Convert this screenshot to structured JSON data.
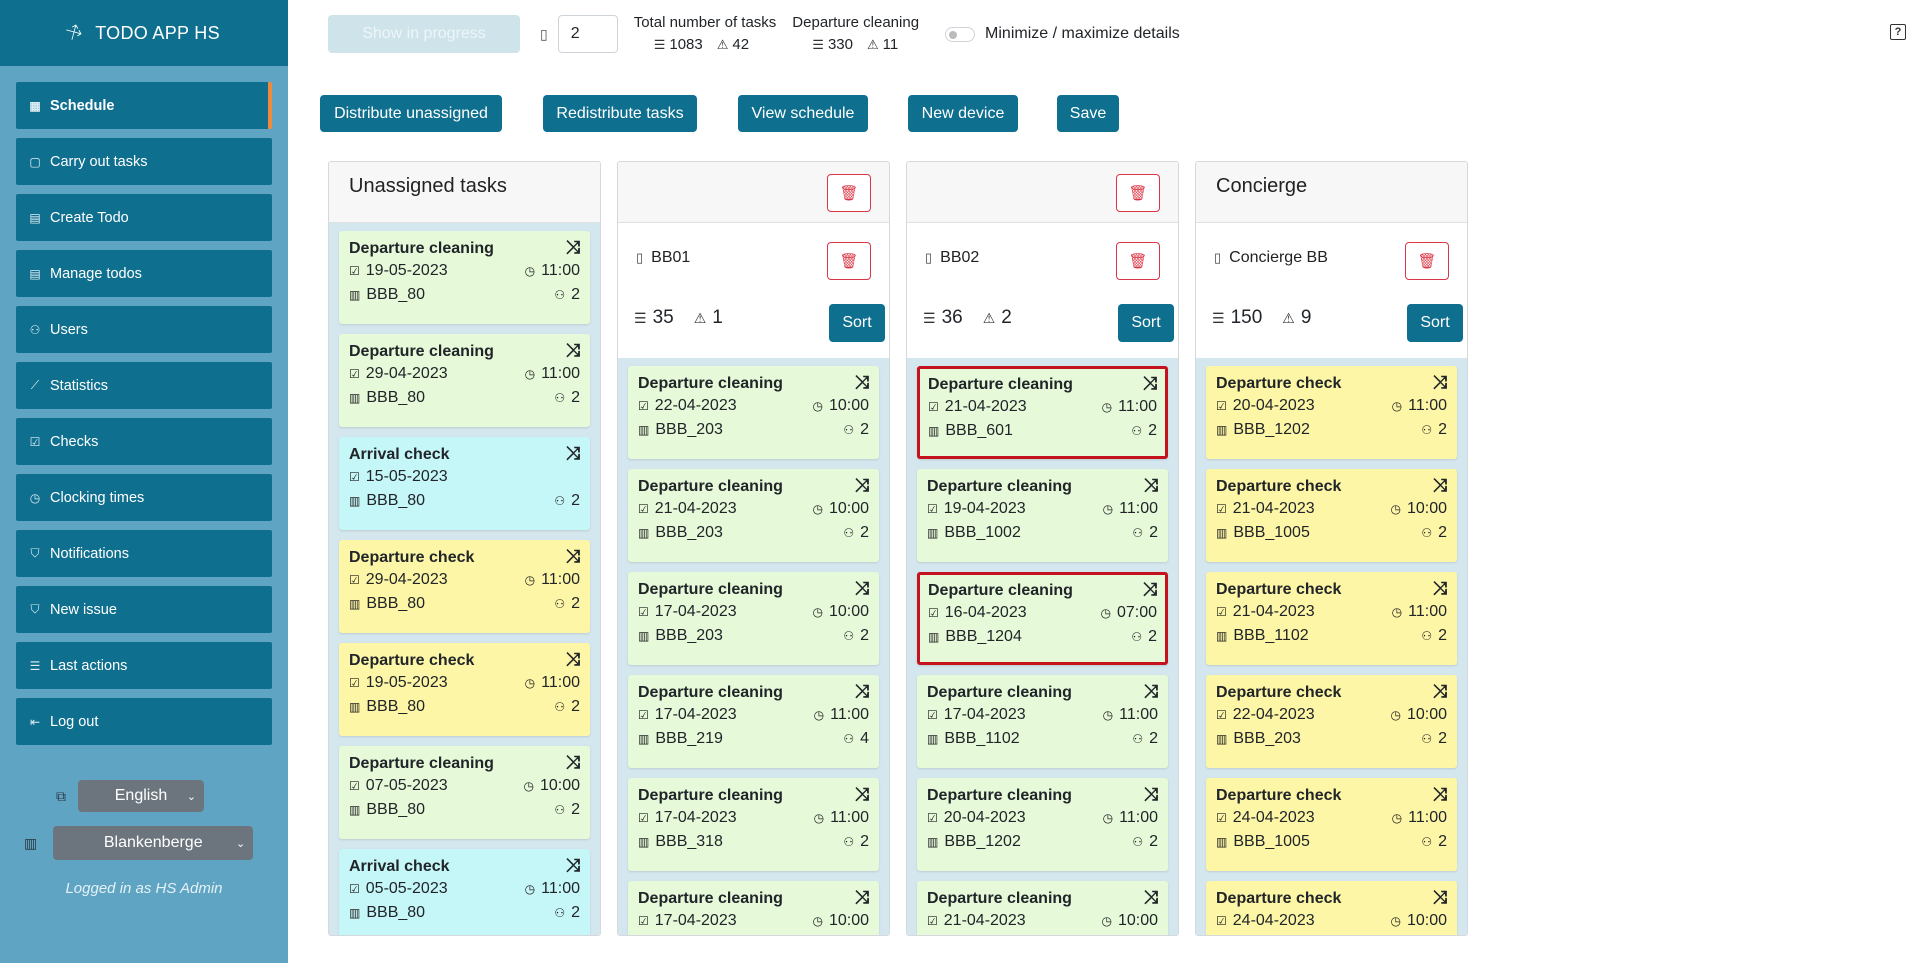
{
  "app": {
    "title": "TODO APP HS"
  },
  "sidebar": {
    "items": [
      {
        "label": "Schedule",
        "icon": "table-icon",
        "glyph": "▦",
        "active": true
      },
      {
        "label": "Carry out tasks",
        "icon": "cup-icon",
        "glyph": "▢"
      },
      {
        "label": "Create Todo",
        "icon": "clipboard-icon",
        "glyph": "▤"
      },
      {
        "label": "Manage todos",
        "icon": "clipboard-check-icon",
        "glyph": "▤"
      },
      {
        "label": "Users",
        "icon": "users-icon",
        "glyph": "⚇"
      },
      {
        "label": "Statistics",
        "icon": "chart-line-icon",
        "glyph": "⟋"
      },
      {
        "label": "Checks",
        "icon": "check-square-icon",
        "glyph": "☑"
      },
      {
        "label": "Clocking times",
        "icon": "clock-icon",
        "glyph": "◷"
      },
      {
        "label": "Notifications",
        "icon": "shield-exclamation-icon",
        "glyph": "⛉"
      },
      {
        "label": "New issue",
        "icon": "shield-plus-icon",
        "glyph": "⛉"
      },
      {
        "label": "Last actions",
        "icon": "person-lines-icon",
        "glyph": "☰"
      },
      {
        "label": "Log out",
        "icon": "box-arrow-left-icon",
        "glyph": "⇤"
      }
    ],
    "language": "English",
    "location": "Blankenberge",
    "logged_in": "Logged in as HS Admin"
  },
  "toolbar": {
    "show_in_progress": "Show in progress",
    "device_count": "2",
    "total_label": "Total number of tasks",
    "total_tasks": "1083",
    "total_urgent": "42",
    "departure_label": "Departure cleaning",
    "departure_tasks": "330",
    "departure_urgent": "11",
    "toggle_label": "Minimize / maximize details"
  },
  "actions": {
    "distribute": "Distribute unassigned",
    "redistribute": "Redistribute tasks",
    "view_schedule": "View schedule",
    "new_device": "New device",
    "save": "Save"
  },
  "columns": [
    {
      "title": "Unassigned tasks",
      "cards": [
        {
          "title": "Departure cleaning",
          "date": "19-05-2023",
          "time": "11:00",
          "room": "BBB_80",
          "people": "2",
          "color": "green"
        },
        {
          "title": "Departure cleaning",
          "date": "29-04-2023",
          "time": "11:00",
          "room": "BBB_80",
          "people": "2",
          "color": "green"
        },
        {
          "title": "Arrival check",
          "date": "15-05-2023",
          "time": "",
          "room": "BBB_80",
          "people": "2",
          "color": "cyan"
        },
        {
          "title": "Departure check",
          "date": "29-04-2023",
          "time": "11:00",
          "room": "BBB_80",
          "people": "2",
          "color": "yellow"
        },
        {
          "title": "Departure check",
          "date": "19-05-2023",
          "time": "11:00",
          "room": "BBB_80",
          "people": "2",
          "color": "yellow"
        },
        {
          "title": "Departure cleaning",
          "date": "07-05-2023",
          "time": "10:00",
          "room": "BBB_80",
          "people": "2",
          "color": "green"
        },
        {
          "title": "Arrival check",
          "date": "05-05-2023",
          "time": "11:00",
          "room": "BBB_80",
          "people": "2",
          "color": "cyan"
        }
      ]
    },
    {
      "title": "",
      "device": "BB01",
      "tasks": "35",
      "urgent": "1",
      "sort": "Sort",
      "cards": [
        {
          "title": "Departure cleaning",
          "date": "22-04-2023",
          "time": "10:00",
          "room": "BBB_203",
          "people": "2",
          "color": "green"
        },
        {
          "title": "Departure cleaning",
          "date": "21-04-2023",
          "time": "10:00",
          "room": "BBB_203",
          "people": "2",
          "color": "green"
        },
        {
          "title": "Departure cleaning",
          "date": "17-04-2023",
          "time": "10:00",
          "room": "BBB_203",
          "people": "2",
          "color": "green"
        },
        {
          "title": "Departure cleaning",
          "date": "17-04-2023",
          "time": "11:00",
          "room": "BBB_219",
          "people": "4",
          "color": "green"
        },
        {
          "title": "Departure cleaning",
          "date": "17-04-2023",
          "time": "11:00",
          "room": "BBB_318",
          "people": "2",
          "color": "green"
        },
        {
          "title": "Departure cleaning",
          "date": "17-04-2023",
          "time": "10:00",
          "room": "",
          "people": "",
          "color": "green"
        }
      ]
    },
    {
      "title": "",
      "device": "BB02",
      "tasks": "36",
      "urgent": "2",
      "sort": "Sort",
      "cards": [
        {
          "title": "Departure cleaning",
          "date": "21-04-2023",
          "time": "11:00",
          "room": "BBB_601",
          "people": "2",
          "color": "green",
          "alert": true
        },
        {
          "title": "Departure cleaning",
          "date": "19-04-2023",
          "time": "11:00",
          "room": "BBB_1002",
          "people": "2",
          "color": "green"
        },
        {
          "title": "Departure cleaning",
          "date": "16-04-2023",
          "time": "07:00",
          "room": "BBB_1204",
          "people": "2",
          "color": "green",
          "alert": true
        },
        {
          "title": "Departure cleaning",
          "date": "17-04-2023",
          "time": "11:00",
          "room": "BBB_1102",
          "people": "2",
          "color": "green"
        },
        {
          "title": "Departure cleaning",
          "date": "20-04-2023",
          "time": "11:00",
          "room": "BBB_1202",
          "people": "2",
          "color": "green"
        },
        {
          "title": "Departure cleaning",
          "date": "21-04-2023",
          "time": "10:00",
          "room": "",
          "people": "",
          "color": "green"
        }
      ]
    },
    {
      "title": "Concierge",
      "device": "Concierge BB",
      "tasks": "150",
      "urgent": "9",
      "sort": "Sort",
      "cards": [
        {
          "title": "Departure check",
          "date": "20-04-2023",
          "time": "11:00",
          "room": "BBB_1202",
          "people": "2",
          "color": "yellow"
        },
        {
          "title": "Departure check",
          "date": "21-04-2023",
          "time": "10:00",
          "room": "BBB_1005",
          "people": "2",
          "color": "yellow"
        },
        {
          "title": "Departure check",
          "date": "21-04-2023",
          "time": "11:00",
          "room": "BBB_1102",
          "people": "2",
          "color": "yellow"
        },
        {
          "title": "Departure check",
          "date": "22-04-2023",
          "time": "10:00",
          "room": "BBB_203",
          "people": "2",
          "color": "yellow"
        },
        {
          "title": "Departure check",
          "date": "24-04-2023",
          "time": "11:00",
          "room": "BBB_1005",
          "people": "2",
          "color": "yellow"
        },
        {
          "title": "Departure check",
          "date": "24-04-2023",
          "time": "10:00",
          "room": "",
          "people": "",
          "color": "yellow"
        }
      ]
    }
  ],
  "colors": {
    "primary": "#0f6f8f",
    "sidebar": "#5fa4c2",
    "danger": "#dc3545",
    "alert_border": "#c5121f",
    "green_card": "#e6f9d9",
    "cyan_card": "#c5f6f8",
    "yellow_card": "#fdf6a6",
    "list_bg": "#d5e7ee"
  }
}
